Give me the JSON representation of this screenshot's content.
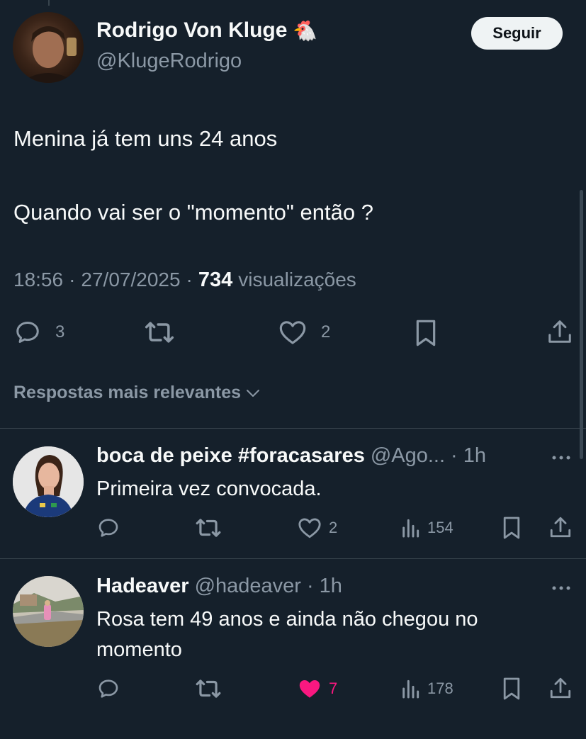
{
  "tweet": {
    "author_name": "Rodrigo Von Kluge",
    "author_emoji": "🐔",
    "author_handle": "@KlugeRodrigo",
    "follow_label": "Seguir",
    "text_line1": "Menina já tem uns 24 anos",
    "text_line2": "Quando vai ser o \"momento\" então ?",
    "time": "18:56",
    "date": "27/07/2025",
    "views_count": "734",
    "views_label": "visualizações",
    "separator": "·",
    "reply_count": "3",
    "like_count": "2"
  },
  "replies_filter": {
    "label": "Respostas mais relevantes"
  },
  "replies": [
    {
      "name": "boca de peixe #foracasares",
      "handle": "@Ago...",
      "time": "1h",
      "text": "Primeira vez convocada.",
      "likes": "2",
      "views": "154",
      "liked": false
    },
    {
      "name": "Hadeaver",
      "handle": "@hadeaver",
      "time": "1h",
      "text_line1": "Rosa tem 49 anos e ainda não chegou no",
      "text_line2": "momento",
      "likes": "7",
      "views": "178",
      "liked": true
    }
  ],
  "colors": {
    "background": "#15202b",
    "text": "#f7f9f9",
    "muted": "#8b98a5",
    "divider": "#38444d",
    "like_active": "#f91880"
  },
  "icons": [
    "comment-icon",
    "retweet-icon",
    "heart-icon",
    "bookmark-icon",
    "share-icon",
    "views-icon",
    "more-icon",
    "chevron-down-icon"
  ]
}
